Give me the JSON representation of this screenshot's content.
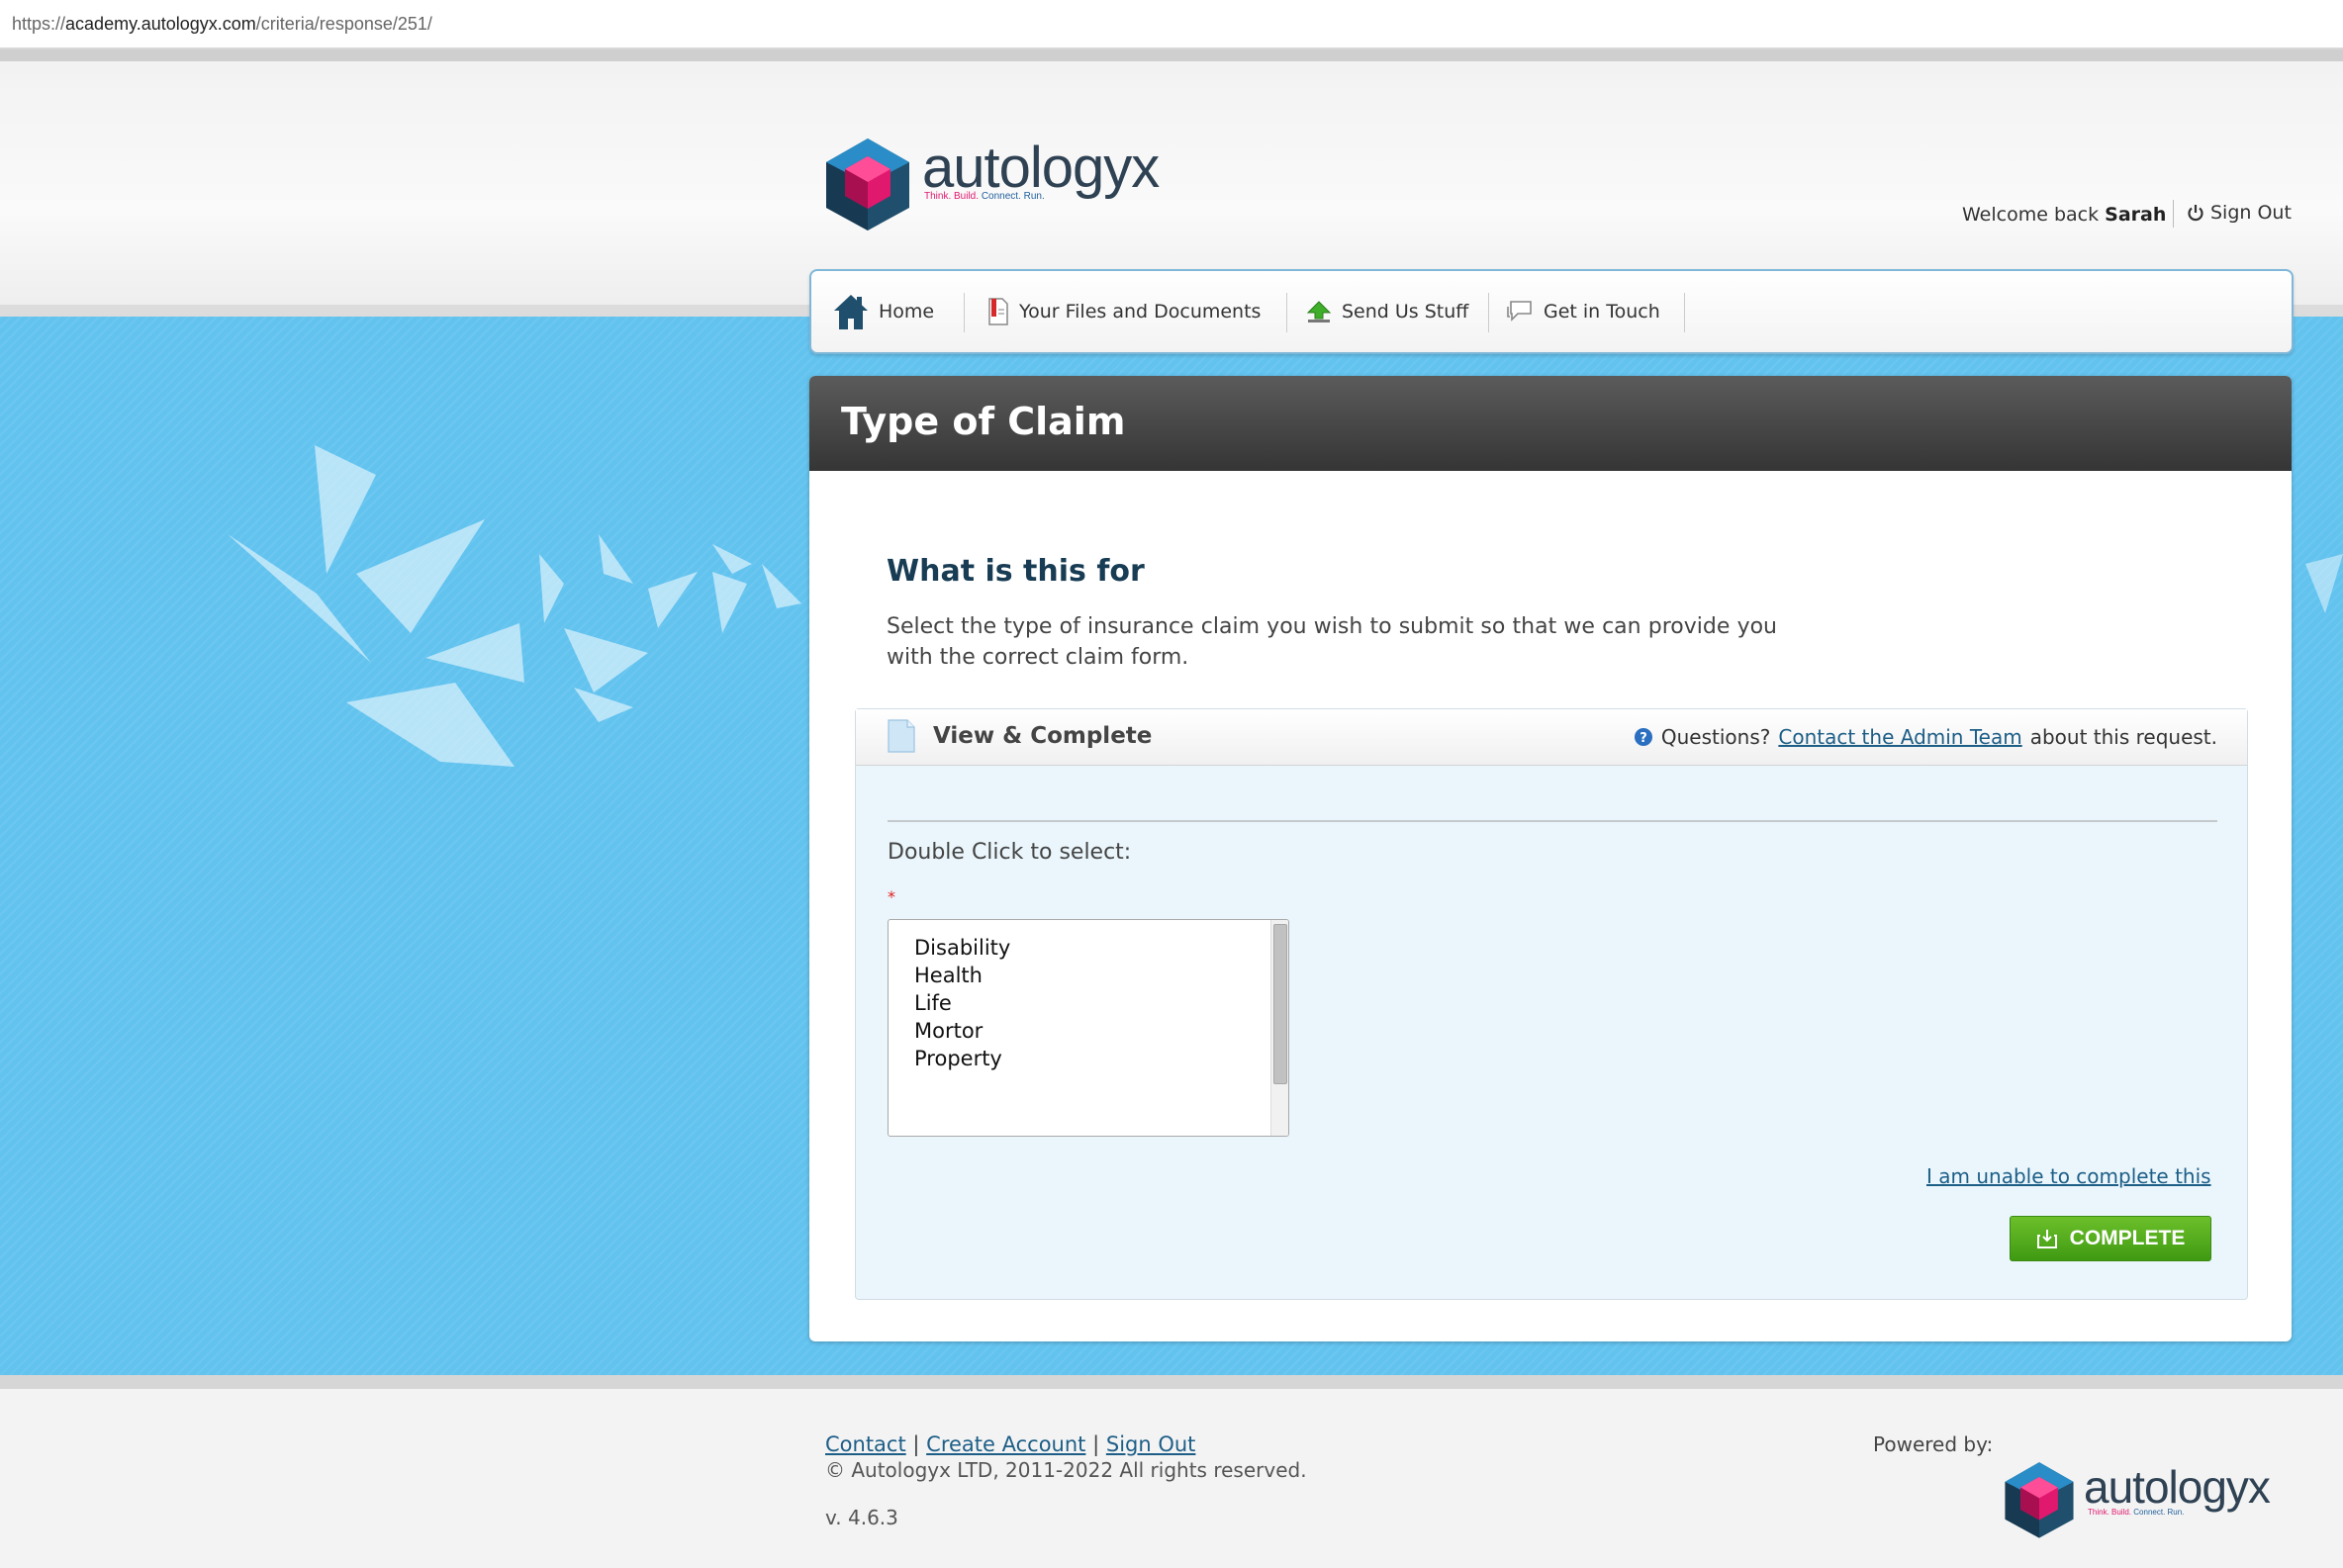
{
  "browser": {
    "url_prefix": "https://",
    "url_host": "academy.autologyx.com",
    "url_path": "/criteria/response/251/"
  },
  "brand": {
    "name": "autologyx",
    "tagline_pink": "Think. Build.",
    "tagline_blue": "Connect. Run."
  },
  "header": {
    "welcome_prefix": "Welcome back",
    "user_name": "Sarah",
    "signout_label": "Sign Out"
  },
  "nav": {
    "items": [
      {
        "label": "Home",
        "icon": "home-icon"
      },
      {
        "label": "Your Files and Documents",
        "icon": "document-icon"
      },
      {
        "label": "Send Us Stuff",
        "icon": "upload-icon"
      },
      {
        "label": "Get in Touch",
        "icon": "chat-icon"
      }
    ]
  },
  "page": {
    "title": "Type of Claim"
  },
  "section": {
    "title": "What is this for",
    "description": "Select the type of insurance claim you wish to submit so that we can provide you with the correct claim form."
  },
  "task": {
    "header": "View & Complete",
    "questions_prefix": "Questions?",
    "contact_link": "Contact the Admin Team",
    "questions_suffix": "about this request.",
    "instruction": "Double Click to select:",
    "required_mark": "*",
    "options": [
      "Disability",
      "Health",
      "Life",
      "Mortor",
      "Property"
    ],
    "unable_link": "I am unable to complete this",
    "complete_label": "COMPLETE"
  },
  "footer": {
    "links": [
      "Contact",
      "Create Account",
      "Sign Out"
    ],
    "separator": "|",
    "copyright": "© Autologyx LTD, 2011-2022 All rights reserved.",
    "version": "v. 4.6.3",
    "powered_by": "Powered by:"
  },
  "colors": {
    "accent_blue": "#63c3ef",
    "title_bar": "#3b3b3b",
    "complete_green": "#4ea81a",
    "link_blue": "#1d5e87",
    "brand_navy": "#2f4254",
    "brand_pink": "#e0186e"
  }
}
